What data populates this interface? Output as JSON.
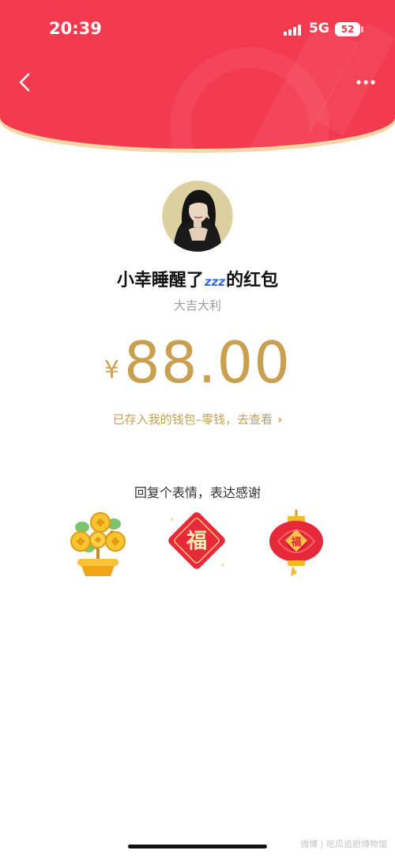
{
  "status_bar": {
    "time": "20:39",
    "network": "5G",
    "battery": "52"
  },
  "header": {
    "back_icon": "chevron-left-icon",
    "more_icon": "ellipsis-icon",
    "color": "#f43a4f"
  },
  "red_packet": {
    "sender_prefix": "小幸睡醒了",
    "sender_emoji": "zzz",
    "sender_suffix": "的红包",
    "blessing": "大吉大利",
    "currency": "¥",
    "amount": "88.00",
    "wallet_text": "已存入我的钱包–零钱，去查看",
    "wallet_chevron": "›",
    "amount_color": "#c9a04f"
  },
  "reply": {
    "prompt": "回复个表情，表达感谢",
    "stickers": [
      "money-tree-icon",
      "fu-character-icon",
      "red-lantern-icon"
    ],
    "fu_text": "福"
  },
  "watermark": "微博 | 吃瓜追剧博物馆"
}
